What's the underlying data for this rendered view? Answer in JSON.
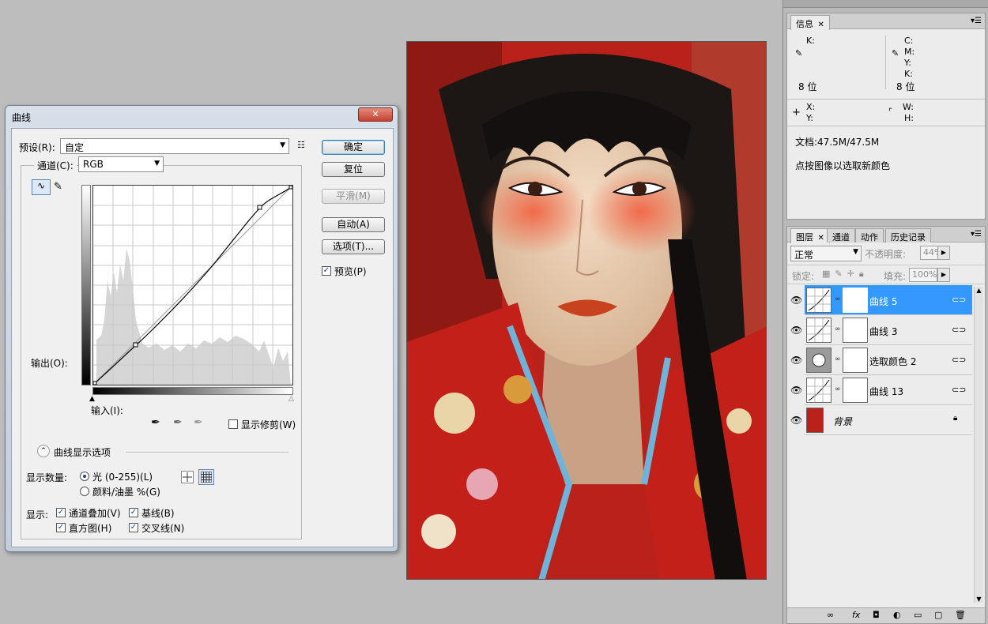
{
  "curves": {
    "title": "曲线",
    "preset_label": "预设(R):",
    "preset_value": "自定",
    "channel_label": "通道(C):",
    "channel_value": "RGB",
    "output_label": "输出(O):",
    "input_label": "输入(I):",
    "buttons": {
      "ok": "确定",
      "reset": "复位",
      "smooth": "平滑(M)",
      "auto": "自动(A)",
      "options": "选项(T)...",
      "preview": "预览(P)"
    },
    "show_clipping": "显示修剪(W)",
    "display_options": "曲线显示选项",
    "show_amount_label": "显示数量:",
    "light_option": "光 (0-255)(L)",
    "pigment_option": "颜料/油墨 %(G)",
    "show_label": "显示:",
    "show_channel_overlays": "通道叠加(V)",
    "show_baseline": "基线(B)",
    "show_histogram": "直方图(H)",
    "show_intersection": "交叉线(N)"
  },
  "info_panel": {
    "tab": "信息",
    "k_left": "K:",
    "bits_left": "8 位",
    "c": "C:",
    "m": "M:",
    "y": "Y:",
    "k": "K:",
    "bits_right": "8 位",
    "x": "X:",
    "y2": "Y:",
    "w": "W:",
    "h": "H:",
    "doc": "文档:47.5M/47.5M",
    "hint": "点按图像以选取新颜色"
  },
  "layers_panel": {
    "tabs": [
      "图层",
      "通道",
      "动作",
      "历史记录"
    ],
    "blend_mode": "正常",
    "opacity_label": "不透明度:",
    "opacity_value": "44%",
    "lock_label": "锁定:",
    "fill_label": "填充:",
    "fill_value": "100%",
    "layers": [
      {
        "name": "曲线 5",
        "type": "curves",
        "selected": true
      },
      {
        "name": "曲线 3",
        "type": "curves",
        "selected": false
      },
      {
        "name": "选取颜色 2",
        "type": "selective",
        "selected": false
      },
      {
        "name": "曲线 13",
        "type": "curves",
        "selected": false
      },
      {
        "name": "背景",
        "type": "background",
        "selected": false
      }
    ]
  },
  "icons": [
    "close-icon",
    "eye-icon",
    "link-icon",
    "lock-icon",
    "eyedropper-icon",
    "curve-tool-icon",
    "pencil-icon",
    "grid-icon",
    "menu-icon",
    "trash-icon"
  ],
  "colors": {
    "selection": "#3399ff",
    "dialog_frame": "#c3cedb",
    "close_button": "#c8402f",
    "photo_red": "#c4201a"
  }
}
